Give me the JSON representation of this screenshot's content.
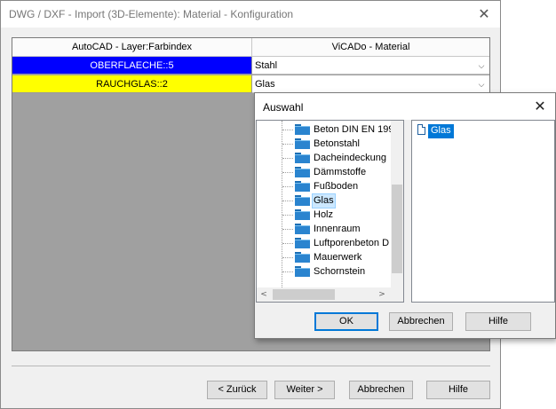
{
  "window": {
    "title": "DWG / DXF - Import (3D-Elemente): Material - Konfiguration",
    "close_glyph": "✕"
  },
  "grid": {
    "headers": [
      "AutoCAD - Layer:Farbindex",
      "ViCADo - Material"
    ],
    "rows": [
      {
        "layer": "OBERFLAECHE::5",
        "material": "Stahl",
        "bg": "#0000ff",
        "fg": "#ffffff"
      },
      {
        "layer": "RAUCHGLAS::2",
        "material": "Glas",
        "bg": "#ffff00",
        "fg": "#000000"
      }
    ],
    "dropdown_glyph": "⌵"
  },
  "buttons": {
    "back": "< Zurück",
    "next": "Weiter >",
    "cancel": "Abbrechen",
    "help": "Hilfe"
  },
  "dialog": {
    "title": "Auswahl",
    "close_glyph": "✕",
    "tree_items": [
      "Beton DIN EN 199",
      "Betonstahl",
      "Dacheindeckung",
      "Dämmstoffe",
      "Fußboden",
      "Glas",
      "Holz",
      "Innenraum",
      "Luftporenbeton D",
      "Mauerwerk",
      "Schornstein"
    ],
    "selected_tree_item": "Glas",
    "list_items": [
      "Glas"
    ],
    "buttons": {
      "ok": "OK",
      "cancel": "Abbrechen",
      "help": "Hilfe"
    },
    "scroll_arrows": {
      "left": "<",
      "right": ">"
    }
  },
  "colors": {
    "accent": "#0078d7",
    "folder": "#2a84cf",
    "grid_bg": "#a0a0a0"
  }
}
